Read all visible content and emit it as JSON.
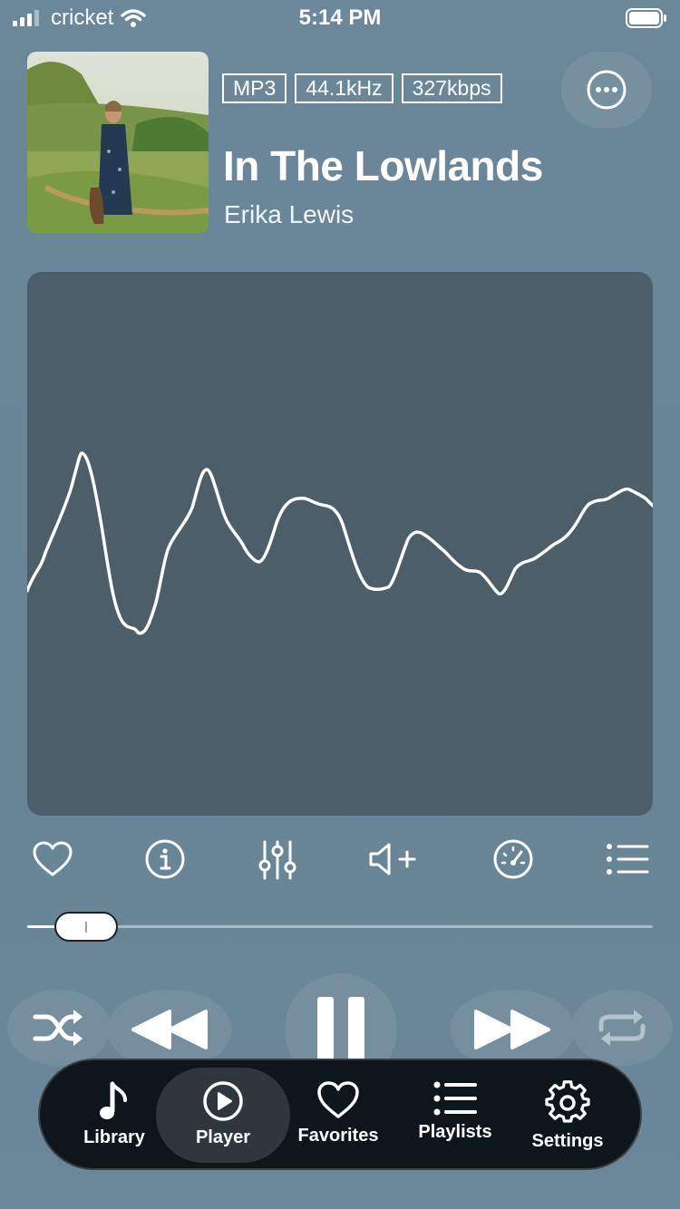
{
  "status_bar": {
    "carrier": "cricket",
    "time": "5:14 PM"
  },
  "now_playing": {
    "badges": [
      "MP3",
      "44.1kHz",
      "327kbps"
    ],
    "title": "In The Lowlands",
    "artist": "Erika Lewis",
    "progress_fraction": 0.05
  },
  "actions": [
    "heart-icon",
    "info-icon",
    "equalizer-icon",
    "volume-plus-icon",
    "speed-icon",
    "queue-icon"
  ],
  "transport": [
    "shuffle-icon",
    "rewind-icon",
    "pause-icon",
    "fast-forward-icon",
    "repeat-icon"
  ],
  "tab_bar": {
    "items": [
      {
        "label": "Library",
        "icon": "music-note-icon"
      },
      {
        "label": "Player",
        "icon": "play-circle-icon",
        "active": true
      },
      {
        "label": "Favorites",
        "icon": "heart-icon"
      },
      {
        "label": "Playlists",
        "icon": "list-icon"
      },
      {
        "label": "Settings",
        "icon": "gear-icon"
      }
    ]
  },
  "colors": {
    "background": "#6b8799",
    "panel": "#4b5e69",
    "tab_bar": "#0d171b",
    "accent": "#ffffff"
  }
}
